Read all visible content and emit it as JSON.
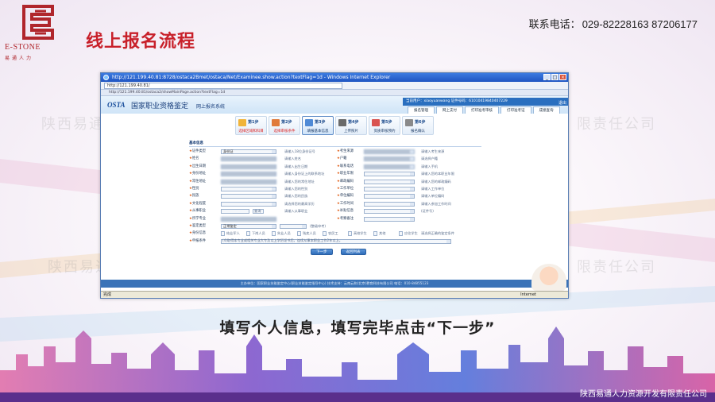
{
  "slide": {
    "title": "线上报名流程",
    "phone_label": "联系电话：",
    "phone_numbers": "029-82228163 87206177",
    "caption": "填写个人信息，填写完毕点击“下一步”",
    "watermark_left": "陕西易通",
    "watermark_right": "限责任公司",
    "watermark_left2": "陕西易通",
    "watermark_right2": "限责任公司",
    "footer_company": "陕西易通人力资源开发有限责任公司"
  },
  "logo": {
    "name": "E-STONE",
    "cn": "易通人力",
    "color": "#b0262c"
  },
  "browser": {
    "title": "http://121.199.40.81:8728/ostaca2Bmet/ostaca/Net/Examinee.show.action?textFlag=1d - Windows Internet Explorer",
    "address": "http://121.199.40.81/",
    "tab": "http://121.199.40.81/ostaca2/showMainPage.action?textFlag=1d",
    "status": "完成",
    "zone": "Internet"
  },
  "site": {
    "logo": "OSTA",
    "title": "国家职业资格鉴定",
    "subtitle": "网上报名系统",
    "user_info": "当前用户：xiaoyuanwang   证件号码：61010419840407229",
    "exit": "退出",
    "nav": [
      "报名管理",
      "网上支付",
      "打印准考审核",
      "打印准考证",
      "成绩查询"
    ],
    "footer": "主办单位：国家职业技能鉴定中心(职业技能鉴定指导中心) 技术支持：云南云和(北京)教育科技有限公司 电话：010-84855123"
  },
  "steps": [
    {
      "no": "第1步",
      "label": "选择区域和科目",
      "state": "done"
    },
    {
      "no": "第2步",
      "label": "选择审核条件",
      "state": "done"
    },
    {
      "no": "第3步",
      "label": "填报基本信息",
      "state": "current"
    },
    {
      "no": "第4步",
      "label": "上传照片",
      "state": "todo"
    },
    {
      "no": "第5步",
      "label": "资质审核预约",
      "state": "todo"
    },
    {
      "no": "第6步",
      "label": "报名确认",
      "state": "todo"
    }
  ],
  "form": {
    "section_title": "基本信息",
    "left": [
      {
        "label": "证件类型",
        "value": "身份证",
        "hint": "请输入18位身份证号"
      },
      {
        "label": "姓名",
        "value": "",
        "hint": "请输入姓名"
      },
      {
        "label": "出生日期",
        "value": "",
        "hint": "请输入出生日期"
      },
      {
        "label": "身份地址",
        "value": "",
        "hint": "请输入身份证上的联系地址"
      },
      {
        "label": "常住地址",
        "value": "",
        "hint": "请输入您的常住地址"
      },
      {
        "label": "性别",
        "value": "",
        "hint": "请输入您的性别"
      },
      {
        "label": "民族",
        "value": "",
        "hint": "请输入您的民族"
      },
      {
        "label": "文化程度",
        "value": "",
        "hint": "请选择您的最高学历"
      },
      {
        "label": "从事职业",
        "value": "",
        "hint": "请输入从事职业"
      },
      {
        "label": "所学专业",
        "value": "",
        "hint": ""
      },
      {
        "label": "鉴定类型",
        "value": "正常鉴定",
        "hint": "(整级申考)"
      },
      {
        "label": "身份信息",
        "value": "",
        "hint": ""
      },
      {
        "label": "申报条件",
        "value": "(4)取得本专业或相关专业大专及以上学历证书后，连续从事本职业工作2年以上。",
        "hint": ""
      }
    ],
    "right": [
      {
        "label": "考生来源",
        "hint": "请输入考生来源"
      },
      {
        "label": "户籍",
        "hint": "请选择户籍"
      },
      {
        "label": "联系电话",
        "hint": "请输入手机"
      },
      {
        "label": "职业年限",
        "hint": "请输入您的本职业年限"
      },
      {
        "label": "邮政编码",
        "hint": "请输入您的邮政编码"
      },
      {
        "label": "工作单位",
        "hint": "请输入工作单位"
      },
      {
        "label": "单位编码",
        "hint": "请输入单位编码"
      },
      {
        "label": "工作时间",
        "hint": "请输入参加工作时间"
      },
      {
        "label": "补贴信息",
        "hint": "(证件号)"
      },
      {
        "label": "考察备注",
        "hint": ""
      }
    ],
    "identity_options": [
      "结业军人",
      "下岗人员",
      "失业人员",
      "残疾人员",
      "农民工",
      "高校学生",
      "其他",
      "应往学生"
    ],
    "id_button": "查询",
    "apply_hint": "请选择正确的鉴定条件",
    "next_button": "下一步",
    "back_button": "返回列表"
  },
  "colors": {
    "title_red": "#c8202a",
    "ie_blue": "#1f55c2",
    "button_blue": "#2e6cba"
  }
}
